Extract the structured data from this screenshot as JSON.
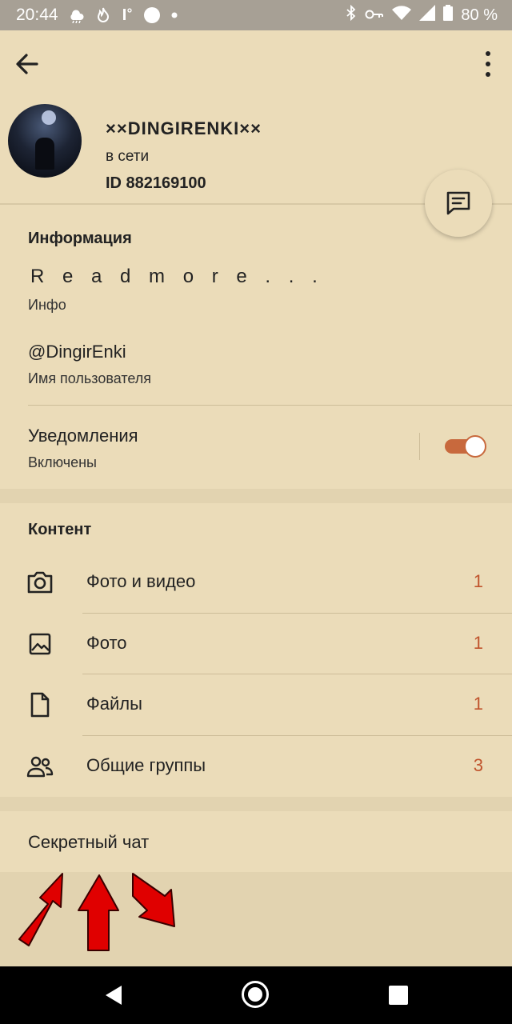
{
  "status_bar": {
    "time": "20:44",
    "battery": "80 %",
    "left_icons": [
      "weather-rain-icon",
      "flame-icon",
      "temperature-icon",
      "circle-icon",
      "dot-icon"
    ],
    "right_icons": [
      "bluetooth-icon",
      "key-icon",
      "wifi-icon",
      "signal-icon",
      "battery-icon"
    ]
  },
  "toolbar": {
    "back_icon": "arrow-left-icon",
    "menu_icon": "more-vertical-icon"
  },
  "profile": {
    "name": "××DINGIRENKI××",
    "status": "в сети",
    "id": "ID 882169100"
  },
  "info": {
    "title": "Информация",
    "bio": "R e a d m o r e . . .",
    "bio_label": "Инфо",
    "username": "@DingirEnki",
    "username_label": "Имя пользователя",
    "notifications": "Уведомления",
    "notifications_state": "Включены",
    "notifications_on": true
  },
  "content": {
    "title": "Контент",
    "items": [
      {
        "label": "Фото и видео",
        "count": "1",
        "icon": "camera-icon"
      },
      {
        "label": "Фото",
        "count": "1",
        "icon": "image-icon"
      },
      {
        "label": "Файлы",
        "count": "1",
        "icon": "file-icon"
      },
      {
        "label": "Общие группы",
        "count": "3",
        "icon": "users-icon"
      }
    ]
  },
  "secret_chat": "Секретный чат",
  "colors": {
    "background": "#ebdcb9",
    "accent": "#c0542d",
    "toggle": "#c8693d",
    "arrow": "#e00000"
  }
}
